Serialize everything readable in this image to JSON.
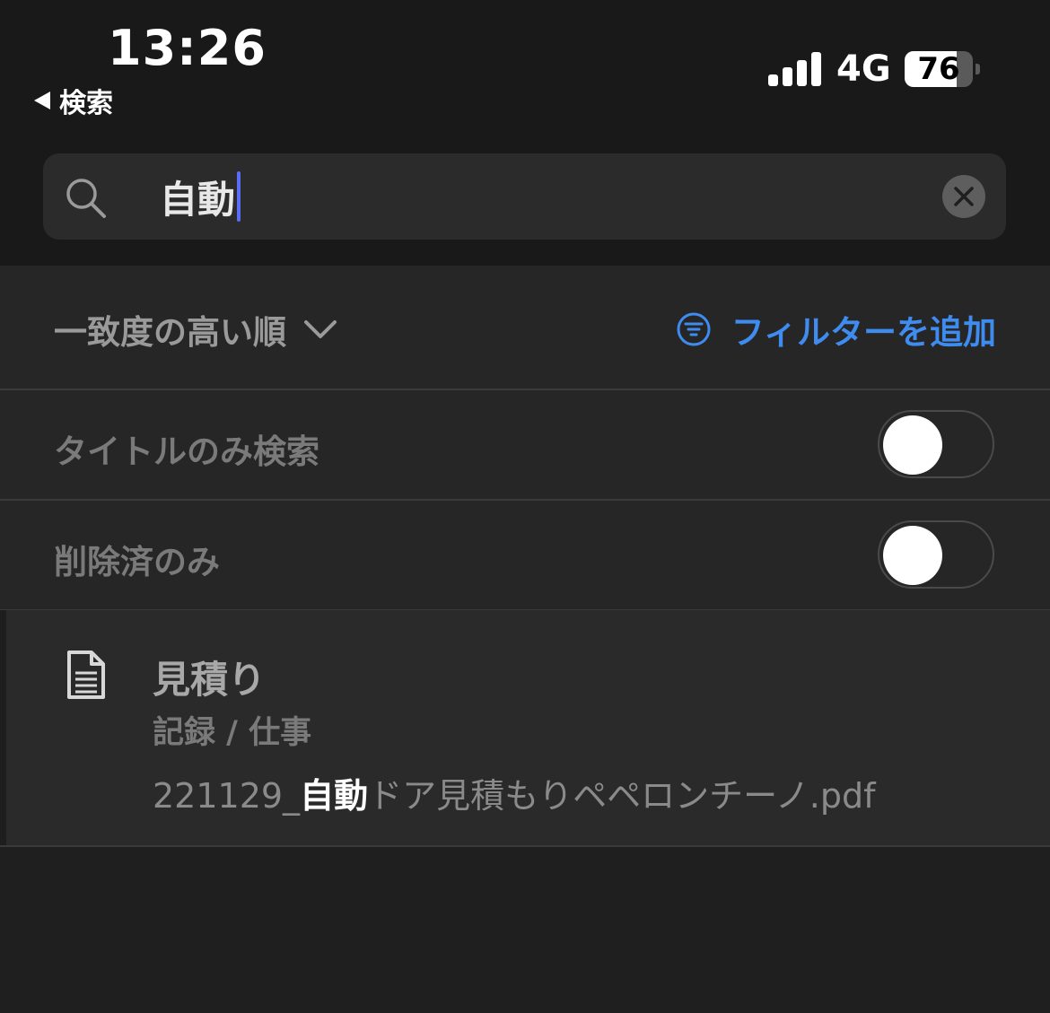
{
  "status_bar": {
    "time": "13:26",
    "back_label": "検索",
    "network": "4G",
    "battery_level": "76",
    "battery_percent": 76
  },
  "search": {
    "query": "自動",
    "icon": "search-icon",
    "clear_icon": "close-icon"
  },
  "sort": {
    "label": "一致度の高い順",
    "icon": "chevron-down-icon"
  },
  "filter": {
    "label": "フィルターを追加",
    "icon": "filter-icon",
    "color": "#3f8cf0"
  },
  "toggles": [
    {
      "label": "タイトルのみ検索",
      "on": false
    },
    {
      "label": "削除済のみ",
      "on": false
    }
  ],
  "results": [
    {
      "icon": "document-icon",
      "title": "見積り",
      "path": "記録 / 仕事",
      "snippet_before": "221129_",
      "snippet_match": "自動",
      "snippet_after": "ドア見積もりペペロンチーノ.pdf"
    }
  ],
  "colors": {
    "background": "#1f1f1f",
    "accent": "#3f8cf0",
    "caret": "#5b6cf5"
  }
}
